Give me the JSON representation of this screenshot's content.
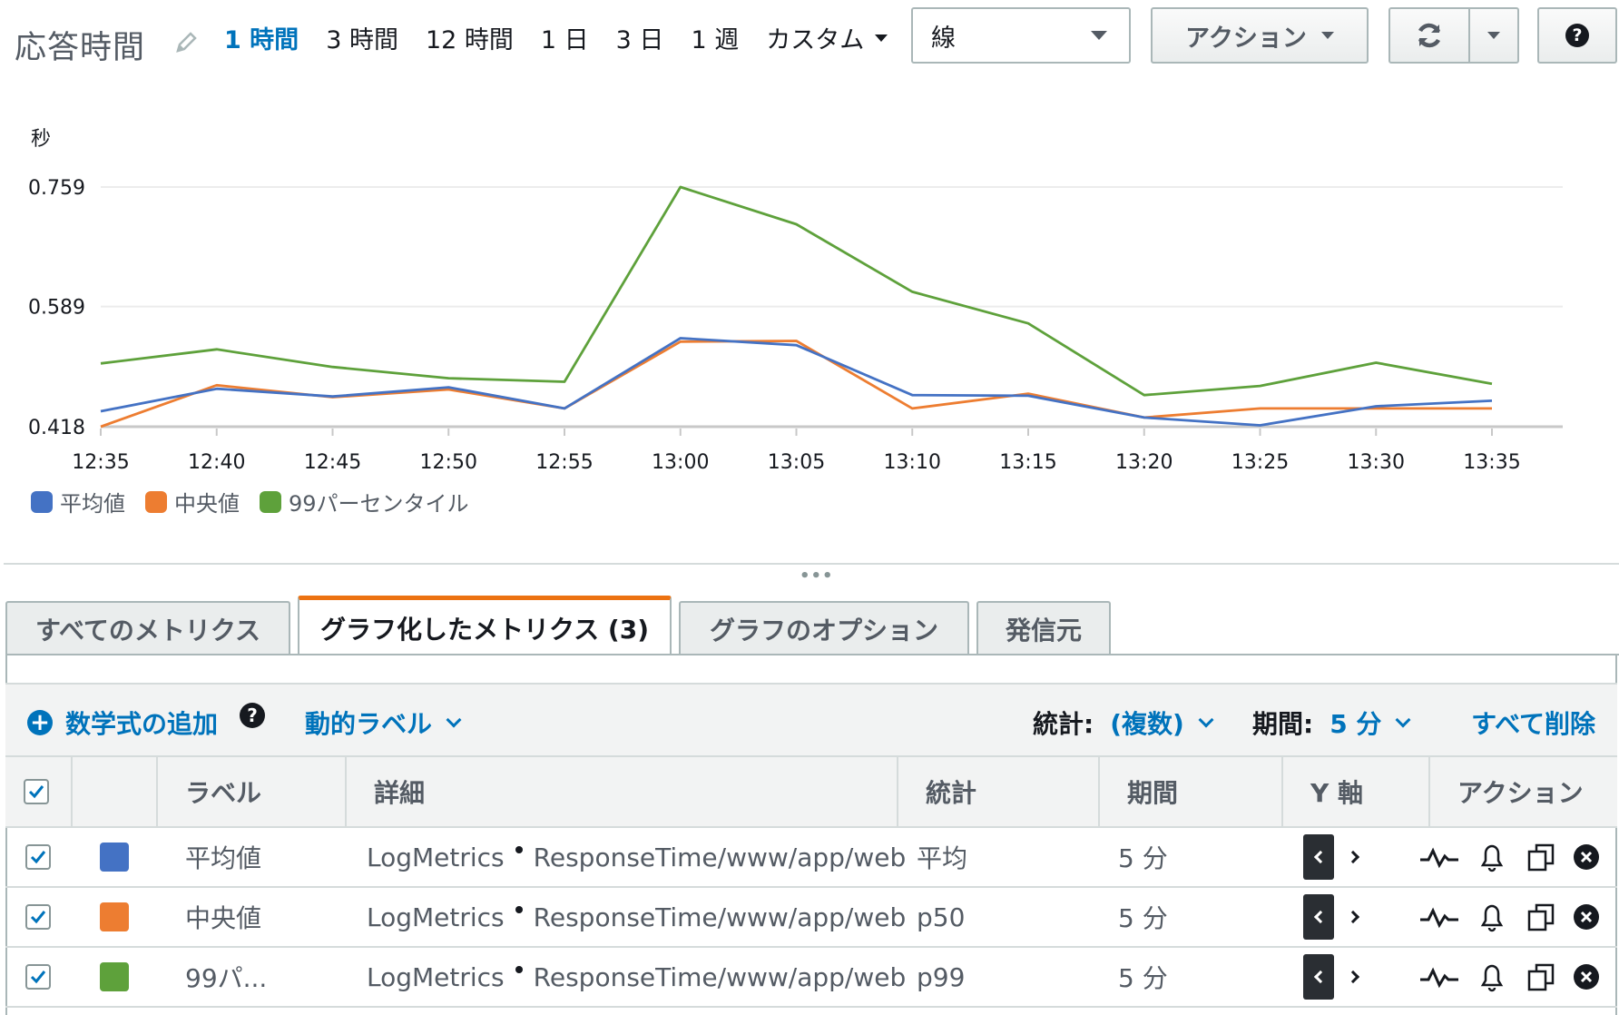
{
  "header": {
    "title": "応答時間",
    "ranges": [
      "1 時間",
      "3 時間",
      "12 時間",
      "1 日",
      "3 日",
      "1 週",
      "カスタム"
    ],
    "active_range": "1 時間",
    "chart_type_select": "線",
    "actions_label": "アクション",
    "help_symbol": "?"
  },
  "chart_data": {
    "type": "line",
    "ylabel": "秒",
    "x": [
      "12:35",
      "12:40",
      "12:45",
      "12:50",
      "12:55",
      "13:00",
      "13:05",
      "13:10",
      "13:15",
      "13:20",
      "13:25",
      "13:30",
      "13:35"
    ],
    "y_ticks": [
      "0.759",
      "0.589",
      "0.418"
    ],
    "ylim": [
      0.418,
      0.759
    ],
    "series": [
      {
        "name": "平均値",
        "color": "#4472c4",
        "values": [
          0.44,
          0.472,
          0.461,
          0.474,
          0.444,
          0.544,
          0.534,
          0.463,
          0.462,
          0.431,
          0.42,
          0.447,
          0.455
        ]
      },
      {
        "name": "中央値",
        "color": "#ed7d31",
        "values": [
          0.418,
          0.477,
          0.46,
          0.471,
          0.444,
          0.539,
          0.54,
          0.444,
          0.465,
          0.431,
          0.444,
          0.444,
          0.444
        ]
      },
      {
        "name": "99パーセンタイル",
        "color": "#5ea13b",
        "values": [
          0.508,
          0.528,
          0.503,
          0.487,
          0.482,
          0.759,
          0.706,
          0.61,
          0.565,
          0.463,
          0.476,
          0.509,
          0.479
        ]
      }
    ],
    "grid": true,
    "legend": "bottom-left"
  },
  "tabs": [
    "すべてのメトリクス",
    "グラフ化したメトリクス (3)",
    "グラフのオプション",
    "発信元"
  ],
  "active_tab": "グラフ化したメトリクス (3)",
  "toolbar": {
    "add_math": "数学式の追加",
    "help_symbol": "?",
    "dynamic_label": "動的ラベル",
    "stats_label": "統計:",
    "stats_value": "(複数)",
    "period_label": "期間:",
    "period_value": "5 分",
    "remove_all": "すべて削除"
  },
  "table": {
    "columns": [
      "ラベル",
      "詳細",
      "統計",
      "期間",
      "Y 軸",
      "アクション"
    ],
    "rows": [
      {
        "color": "#4472c4",
        "label": "平均値",
        "namespace": "LogMetrics",
        "metric": "ResponseTime/www/app/web",
        "stat": "平均",
        "period": "5 分"
      },
      {
        "color": "#ed7d31",
        "label": "中央値",
        "namespace": "LogMetrics",
        "metric": "ResponseTime/www/app/web",
        "stat": "p50",
        "period": "5 分"
      },
      {
        "color": "#5ea13b",
        "label": "99パ...",
        "namespace": "LogMetrics",
        "metric": "ResponseTime/www/app/web",
        "stat": "p99",
        "period": "5 分"
      }
    ]
  }
}
